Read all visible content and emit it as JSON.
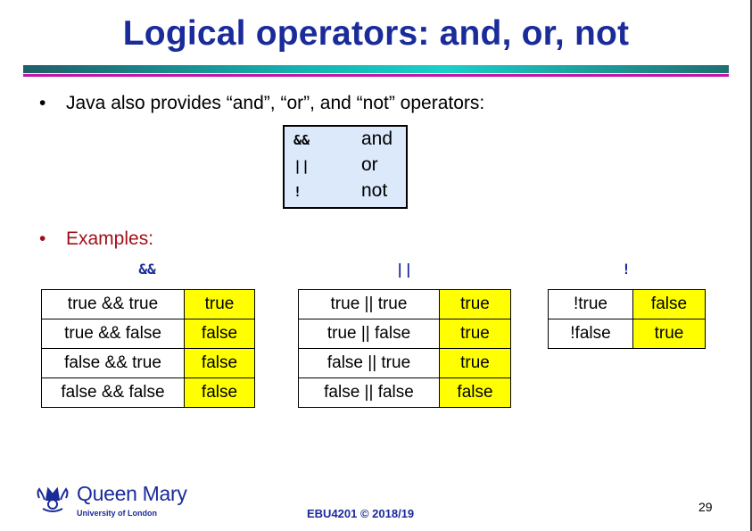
{
  "title": "Logical operators: and, or, not",
  "bullets": {
    "intro": "Java also provides “and”, “or”, and “not” operators:",
    "examples": "Examples:",
    "dot": "•"
  },
  "operators": [
    {
      "symbol": "&&",
      "word": "and"
    },
    {
      "symbol": "||",
      "word": "or"
    },
    {
      "symbol": "!",
      "word": "not"
    }
  ],
  "tables": [
    {
      "heading": "&&",
      "rows": [
        {
          "expr": "true && true",
          "result": "true"
        },
        {
          "expr": "true && false",
          "result": "false"
        },
        {
          "expr": "false && true",
          "result": "false"
        },
        {
          "expr": "false && false",
          "result": "false"
        }
      ]
    },
    {
      "heading": "||",
      "rows": [
        {
          "expr": "true || true",
          "result": "true"
        },
        {
          "expr": "true || false",
          "result": "true"
        },
        {
          "expr": "false || true",
          "result": "true"
        },
        {
          "expr": "false || false",
          "result": "false"
        }
      ]
    },
    {
      "heading": "!",
      "rows": [
        {
          "expr": "!true",
          "result": "false"
        },
        {
          "expr": "!false",
          "result": "true"
        }
      ]
    }
  ],
  "logo": {
    "name": "Queen Mary",
    "subtitle": "University of London",
    "icon": "crown-crest-icon"
  },
  "footer": "EBU4201 © 2018/19",
  "page_number": "29",
  "colors": {
    "title": "#1a2b9a",
    "examples": "#a01018",
    "result_fill": "#ffff00",
    "operator_box": "#dce9fb",
    "rule_magenta": "#c414a8"
  }
}
